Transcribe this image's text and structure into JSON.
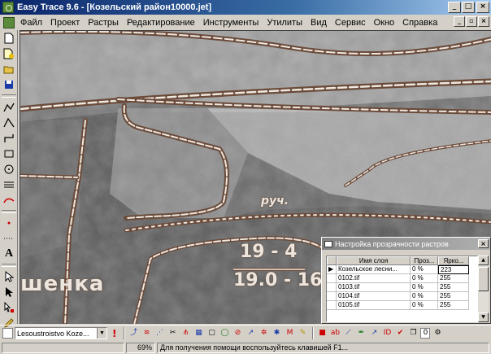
{
  "window": {
    "title": "Easy Trace 9.6 - [Козельский район10000.jet]",
    "minimize_glyph": "_",
    "maximize_glyph": "□",
    "close_glyph": "×"
  },
  "menu": {
    "items": [
      "Файл",
      "Проект",
      "Растры",
      "Редактирование",
      "Инструменты",
      "Утилиты",
      "Вид",
      "Сервис",
      "Окно",
      "Справка"
    ],
    "mdi_minimize": "_",
    "mdi_restore": "▫",
    "mdi_close": "×"
  },
  "map": {
    "labels": {
      "place": "шенка",
      "stream": "руч.",
      "fraction_top": "19 - 4",
      "fraction_bottom": "19.0 - 16"
    }
  },
  "dialog": {
    "title": "Настройка прозрачности растров",
    "close_glyph": "×",
    "columns": [
      "Имя слоя",
      "Проз...",
      "Ярко..."
    ],
    "rows": [
      {
        "marker": "▶",
        "name": "Козельское лесни...",
        "transparency": "0 %",
        "brightness": "223"
      },
      {
        "marker": "",
        "name": "0102.tif",
        "transparency": "0 %",
        "brightness": "255"
      },
      {
        "marker": "",
        "name": "0103.tif",
        "transparency": "0 %",
        "brightness": "255"
      },
      {
        "marker": "",
        "name": "0104.tif",
        "transparency": "0 %",
        "brightness": "255"
      },
      {
        "marker": "",
        "name": "0105.tif",
        "transparency": "0 %",
        "brightness": "255"
      }
    ]
  },
  "bottom_toolbar": {
    "layer_combo": "Lesoustroistvo Koze...",
    "exclamation": "!",
    "number_field": "0"
  },
  "status": {
    "panel1": "",
    "zoom": "69%",
    "hint": "Для получения помощи воспользуйтесь клавишей F1..."
  }
}
